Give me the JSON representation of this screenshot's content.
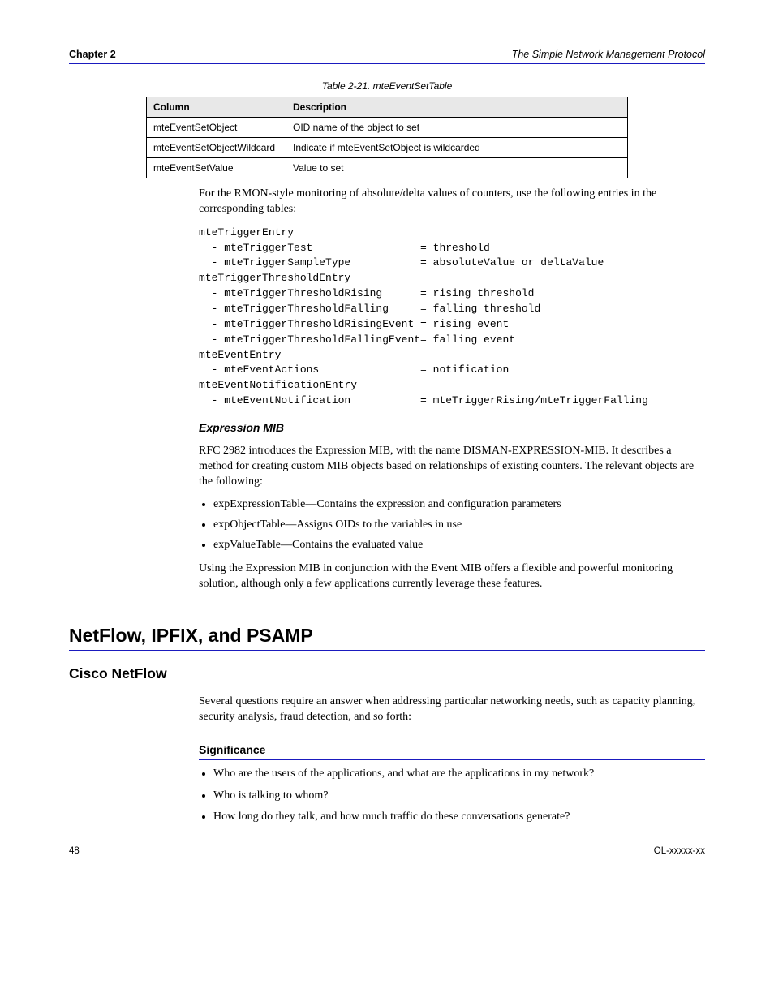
{
  "header": {
    "chapter": "Chapter 2",
    "topic": "The Simple Network Management Protocol"
  },
  "table": {
    "caption": "Table 2-21. mteEventSetTable",
    "headers": [
      "Column",
      "Description"
    ],
    "rows": [
      [
        "mteEventSetObject",
        "OID name of the object to set"
      ],
      [
        "mteEventSetObjectWildcard",
        "Indicate if mteEventSetObject is wildcarded"
      ],
      [
        "mteEventSetValue",
        "Value to set"
      ]
    ]
  },
  "body": {
    "p1": "For the RMON-style monitoring of absolute/delta values of counters, use the following entries in the corresponding tables:",
    "code": "mteTriggerEntry\n  - mteTriggerTest                 = threshold\n  - mteTriggerSampleType           = absoluteValue or deltaValue\nmteTriggerThresholdEntry\n  - mteTriggerThresholdRising      = rising threshold\n  - mteTriggerThresholdFalling     = falling threshold\n  - mteTriggerThresholdRisingEvent = rising event\n  - mteTriggerThresholdFallingEvent= falling event\nmteEventEntry\n  - mteEventActions                = notification\nmteEventNotificationEntry\n  - mteEventNotification           = mteTriggerRising/mteTriggerFalling",
    "subhead1": "Expression MIB",
    "p2": "RFC 2982 introduces the Expression MIB, with the name DISMAN-EXPRESSION-MIB. It describes a method for creating custom MIB objects based on relationships of existing counters. The relevant objects are the following:",
    "bullets": [
      "expExpressionTable—Contains the expression and configuration parameters",
      "expObjectTable—Assigns OIDs to the variables in use",
      "expValueTable—Contains the evaluated value"
    ],
    "p3": "Using the Expression MIB in conjunction with the Event MIB offers a flexible and powerful monitoring solution, although only a few applications currently leverage these features."
  },
  "sections": {
    "h2": "NetFlow, IPFIX, and PSAMP",
    "h3": "Cisco NetFlow",
    "p4": "Several questions require an answer when addressing particular networking needs, such as capacity planning, security analysis, fraud detection, and so forth:",
    "h4": "Significance",
    "bullets2": [
      "Who are the users of the applications, and what are the applications in my network?",
      "Who is talking to whom?",
      "How long do they talk, and how much traffic do these conversations generate?"
    ]
  },
  "footer": {
    "left": "48",
    "right": "OL-xxxxx-xx"
  }
}
